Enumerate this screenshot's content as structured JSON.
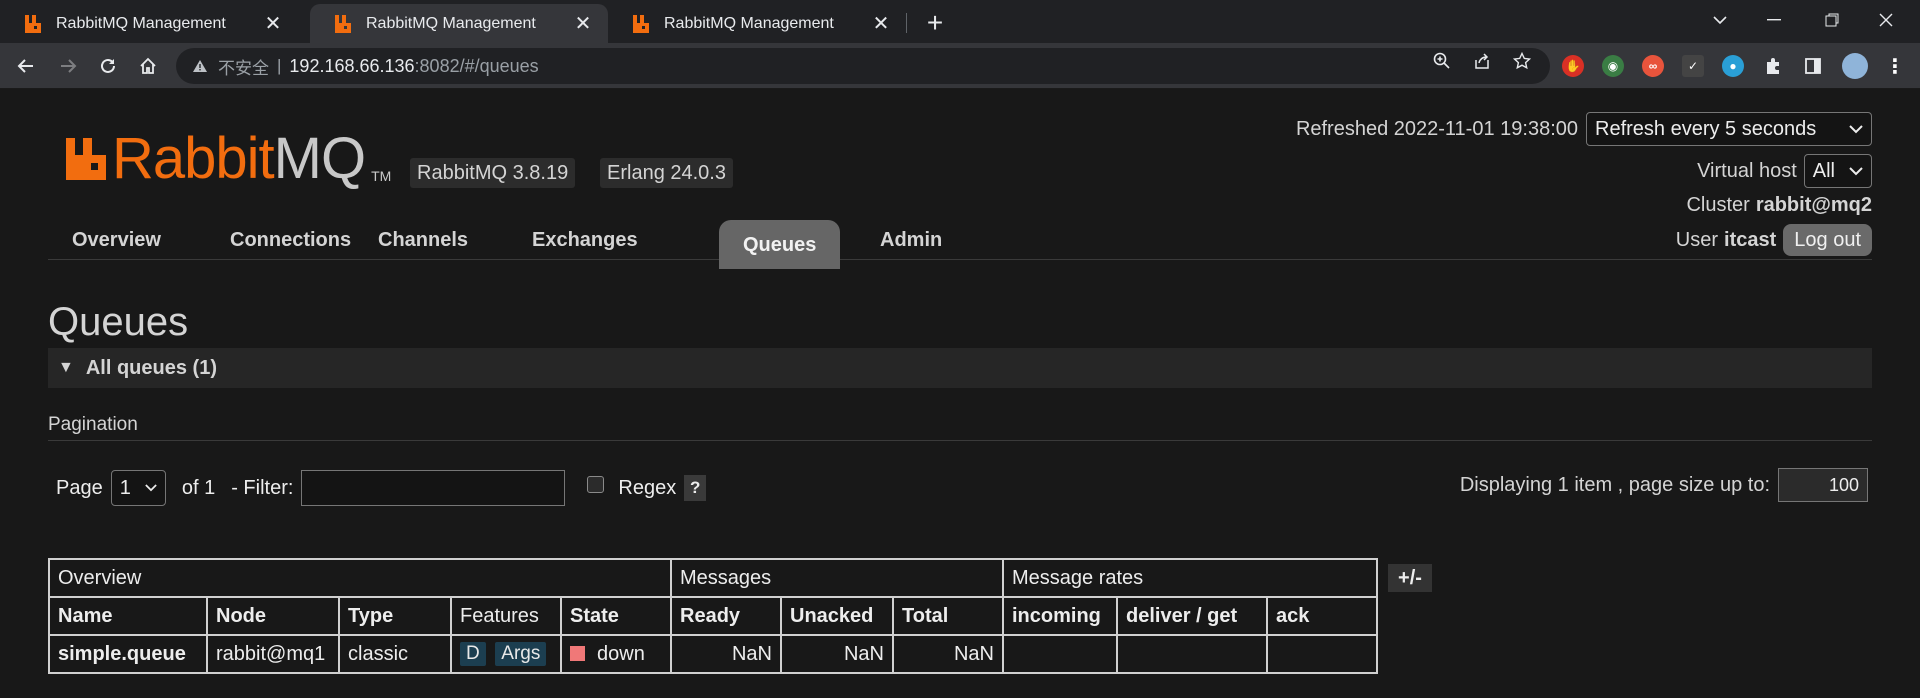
{
  "browser": {
    "tabs": [
      {
        "title": "RabbitMQ Management",
        "active": false
      },
      {
        "title": "RabbitMQ Management",
        "active": true
      },
      {
        "title": "RabbitMQ Management",
        "active": false
      }
    ],
    "address": {
      "security_label": "不安全",
      "divider": "|",
      "host": "192.168.66.136",
      "path": ":8082/#/queues"
    }
  },
  "header": {
    "logo_rabbit": "Rabbit",
    "logo_mq": "MQ",
    "logo_tm": "TM",
    "rabbitmq_version": "RabbitMQ 3.8.19",
    "erlang_version": "Erlang 24.0.3",
    "refreshed_label": "Refreshed 2022-11-01 19:38:00",
    "refresh_select": "Refresh every 5 seconds",
    "vhost_label": "Virtual host",
    "vhost_select": "All",
    "cluster_label": "Cluster",
    "cluster_name": "rabbit@mq2",
    "user_label": "User",
    "user_name": "itcast",
    "logout_label": "Log out"
  },
  "nav": {
    "tabs": [
      "Overview",
      "Connections",
      "Channels",
      "Exchanges",
      "Queues",
      "Admin"
    ],
    "active": "Queues"
  },
  "main": {
    "title": "Queues",
    "section_title": "All queues (1)",
    "pagination_label": "Pagination",
    "page_label": "Page",
    "page_select": "1",
    "of_label": "of 1",
    "filter_label": "- Filter:",
    "filter_value": "",
    "regex_label": "Regex",
    "help_label": "?",
    "display_label": "Displaying 1 item , page size up to:",
    "page_size": "100",
    "plus_minus": "+/-"
  },
  "table": {
    "groups": [
      "Overview",
      "Messages",
      "Message rates"
    ],
    "columns": [
      "Name",
      "Node",
      "Type",
      "Features",
      "State",
      "Ready",
      "Unacked",
      "Total",
      "incoming",
      "deliver / get",
      "ack"
    ],
    "rows": [
      {
        "name": "simple.queue",
        "node": "rabbit@mq1",
        "type": "classic",
        "features": [
          "D",
          "Args"
        ],
        "state": "down",
        "ready": "NaN",
        "unacked": "NaN",
        "total": "NaN",
        "incoming": "",
        "deliver_get": "",
        "ack": ""
      }
    ]
  },
  "colors": {
    "brand_orange": "#f26d0f",
    "state_down": "#f07878",
    "background": "#181818"
  }
}
